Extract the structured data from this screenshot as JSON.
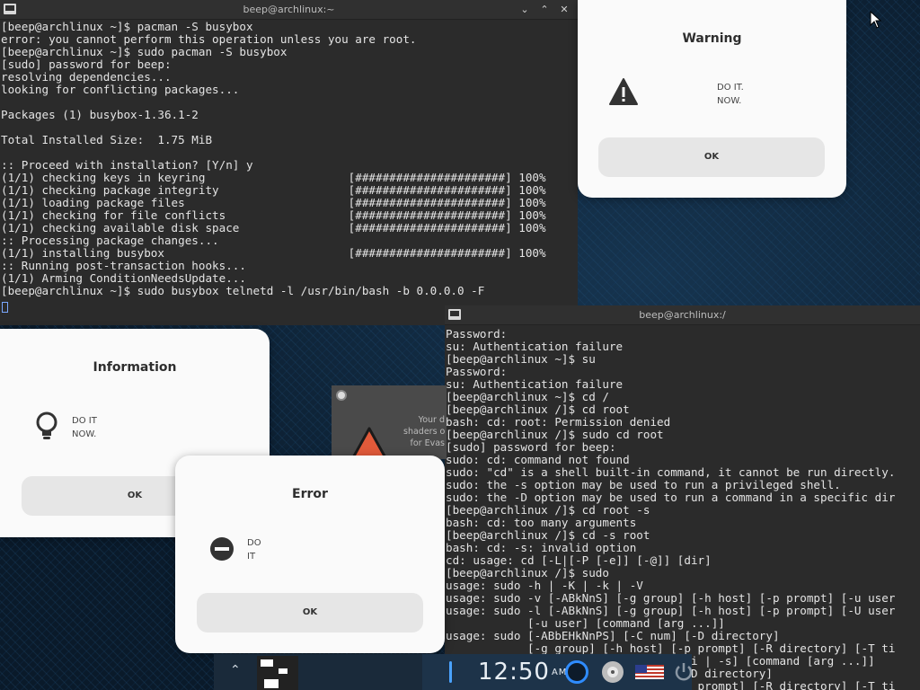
{
  "terminal1": {
    "title": "beep@archlinux:~",
    "buttons": [
      "⌄",
      "⌃",
      "✕"
    ],
    "text": "[beep@archlinux ~]$ pacman -S busybox\nerror: you cannot perform this operation unless you are root.\n[beep@archlinux ~]$ sudo pacman -S busybox\n[sudo] password for beep:\nresolving dependencies...\nlooking for conflicting packages...\n\nPackages (1) busybox-1.36.1-2\n\nTotal Installed Size:  1.75 MiB\n\n:: Proceed with installation? [Y/n] y\n(1/1) checking keys in keyring                     [######################] 100%\n(1/1) checking package integrity                   [######################] 100%\n(1/1) loading package files                        [######################] 100%\n(1/1) checking for file conflicts                  [######################] 100%\n(1/1) checking available disk space                [######################] 100%\n:: Processing package changes...\n(1/1) installing busybox                           [######################] 100%\n:: Running post-transaction hooks...\n(1/1) Arming ConditionNeedsUpdate...\n[beep@archlinux ~]$ sudo busybox telnetd -l /usr/bin/bash -b 0.0.0.0 -F"
  },
  "terminal2": {
    "title": "beep@archlinux:/",
    "text": "Password:\nsu: Authentication failure\n[beep@archlinux ~]$ su\nPassword:\nsu: Authentication failure\n[beep@archlinux ~]$ cd /\n[beep@archlinux /]$ cd root\nbash: cd: root: Permission denied\n[beep@archlinux /]$ sudo cd root\n[sudo] password for beep:\nsudo: cd: command not found\nsudo: \"cd\" is a shell built-in command, it cannot be run directly.\nsudo: the -s option may be used to run a privileged shell.\nsudo: the -D option may be used to run a command in a specific dir\n[beep@archlinux /]$ cd root -s\nbash: cd: too many arguments\n[beep@archlinux /]$ cd -s root\nbash: cd: -s: invalid option\ncd: usage: cd [-L|[-P [-e]] [-@]] [dir]\n[beep@archlinux /]$ sudo\nusage: sudo -h | -K | -k | -V\nusage: sudo -v [-ABkNnS] [-g group] [-h host] [-p prompt] [-u user\nusage: sudo -l [-ABkNnS] [-g group] [-h host] [-p prompt] [-U user\n            [-u user] [command [arg ...]]\nusage: sudo [-ABbEHkNnPS] [-C num] [-D directory]\n            [-g group] [-h host] [-p prompt] [-R directory] [-T ti\n            [-u user] [VAR=value] [-i | -s] [command [arg ...]]\nusage: sudo -e [-ABkNnS] [-C num] [-D directory]\n            [-g group] [-h host] [-p prompt] [-R directory] [-T ti"
  },
  "warning_dialog": {
    "title": "Warning",
    "message": "DO IT.\nNOW.",
    "ok": "OK"
  },
  "info_dialog": {
    "title": "Information",
    "message": "DO IT\nNOW.",
    "ok": "OK"
  },
  "error_dialog": {
    "title": "Error",
    "message": "DO\nIT",
    "ok": "OK"
  },
  "evas_window": {
    "text": "Your d\nshaders o\nfor Evas"
  },
  "panel": {
    "time": "12:50",
    "ampm": "AM"
  },
  "colors": {
    "dialog_bg": "#fafafa",
    "terminal_bg": "#2b2b2b",
    "button_bg": "#e6e6e6"
  }
}
